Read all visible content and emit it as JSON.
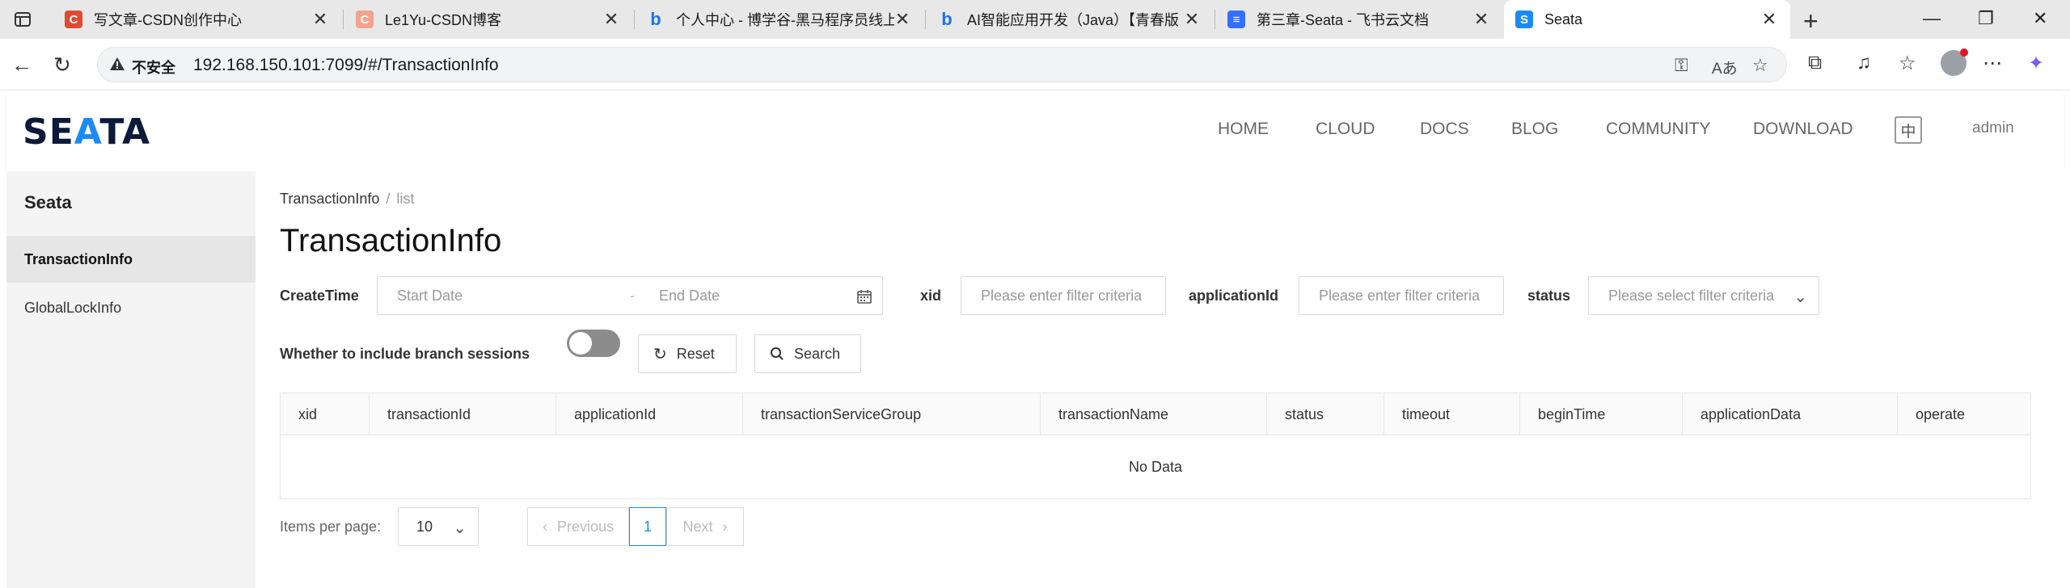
{
  "browser": {
    "tabs": [
      {
        "title": "写文章-CSDN创作中心",
        "fav": "C",
        "fav_color": "#e04a2f"
      },
      {
        "title": "Le1Yu-CSDN博客",
        "fav": "C",
        "fav_color": "#f2a38f"
      },
      {
        "title": "个人中心 - 博学谷-黑马程序员线上",
        "fav": "b",
        "fav_color": "#1a73e8"
      },
      {
        "title": "AI智能应用开发（Java）【青春版",
        "fav": "b",
        "fav_color": "#1a73e8"
      },
      {
        "title": "第三章-Seata - 飞书云文档",
        "fav": "≡",
        "fav_color": "#3370ff"
      },
      {
        "title": "Seata",
        "fav": "S",
        "fav_color": "#1c8af5"
      }
    ],
    "security_label": "不安全",
    "url": "192.168.150.101:7099/#/TransactionInfo"
  },
  "header": {
    "logo_pre": "SE",
    "logo_acc": "A",
    "logo_post": "TA",
    "nav": [
      "HOME",
      "CLOUD",
      "DOCS",
      "BLOG",
      "COMMUNITY",
      "DOWNLOAD"
    ],
    "lang": "中",
    "user": "admin"
  },
  "sidebar": {
    "title": "Seata",
    "items": [
      {
        "label": "TransactionInfo",
        "active": true
      },
      {
        "label": "GlobalLockInfo",
        "active": false
      }
    ]
  },
  "main": {
    "breadcrumb": [
      "TransactionInfo",
      "list"
    ],
    "title": "TransactionInfo",
    "filters": {
      "create_time_label": "CreateTime",
      "start_placeholder": "Start Date",
      "range_sep": "-",
      "end_placeholder": "End Date",
      "xid_label": "xid",
      "xid_placeholder": "Please enter filter criteria",
      "app_label": "applicationId",
      "app_placeholder": "Please enter filter criteria",
      "status_label": "status",
      "status_placeholder": "Please select filter criteria",
      "branch_label": "Whether to include branch sessions",
      "reset_label": "Reset",
      "search_label": "Search"
    },
    "table": {
      "columns": [
        "xid",
        "transactionId",
        "applicationId",
        "transactionServiceGroup",
        "transactionName",
        "status",
        "timeout",
        "beginTime",
        "applicationData",
        "operate"
      ],
      "empty_text": "No Data"
    },
    "pagination": {
      "items_per_page_label": "Items per page:",
      "page_size": "10",
      "previous": "Previous",
      "current": "1",
      "next": "Next"
    }
  },
  "colors": {
    "accent": "#1c8af5",
    "toggle_off": "#8c8c8c"
  }
}
